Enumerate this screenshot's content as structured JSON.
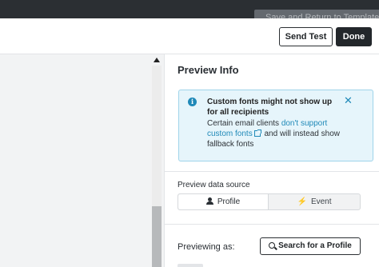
{
  "topbar": {
    "save_return_label": "Save and Return to Template"
  },
  "toolbar": {
    "send_test_label": "Send Test",
    "done_label": "Done"
  },
  "panel": {
    "title": "Preview Info",
    "alert": {
      "icon": "info-icon",
      "title": "Custom fonts might not show up for all recipients",
      "body_prefix": "Certain email clients ",
      "link_text": "don't support custom fonts",
      "body_suffix": " and will instead show fallback fonts",
      "close_icon": "close-icon",
      "accent_color": "#1f89b8"
    },
    "data_source": {
      "label": "Preview data source",
      "options": [
        {
          "label": "Profile",
          "icon": "person-icon",
          "selected": true
        },
        {
          "label": "Event",
          "icon": "bolt-icon",
          "selected": false
        }
      ]
    },
    "previewing": {
      "label": "Previewing as:",
      "search_button": "Search for a Profile",
      "search_icon": "search-icon"
    }
  }
}
